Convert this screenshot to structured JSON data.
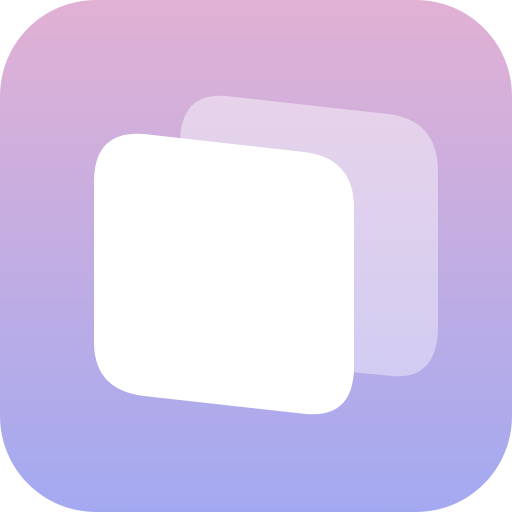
{
  "app_icon": {
    "icon_name": "stacked-cards-app-icon",
    "colors": {
      "background_gradient_top": "#E1B1D4",
      "background_gradient_bottom": "#A3A9F1",
      "back_card_gradient_top": "#E7D3EA",
      "back_card_gradient_bottom": "#D2CCF2",
      "front_card": "#FFFFFF"
    }
  }
}
